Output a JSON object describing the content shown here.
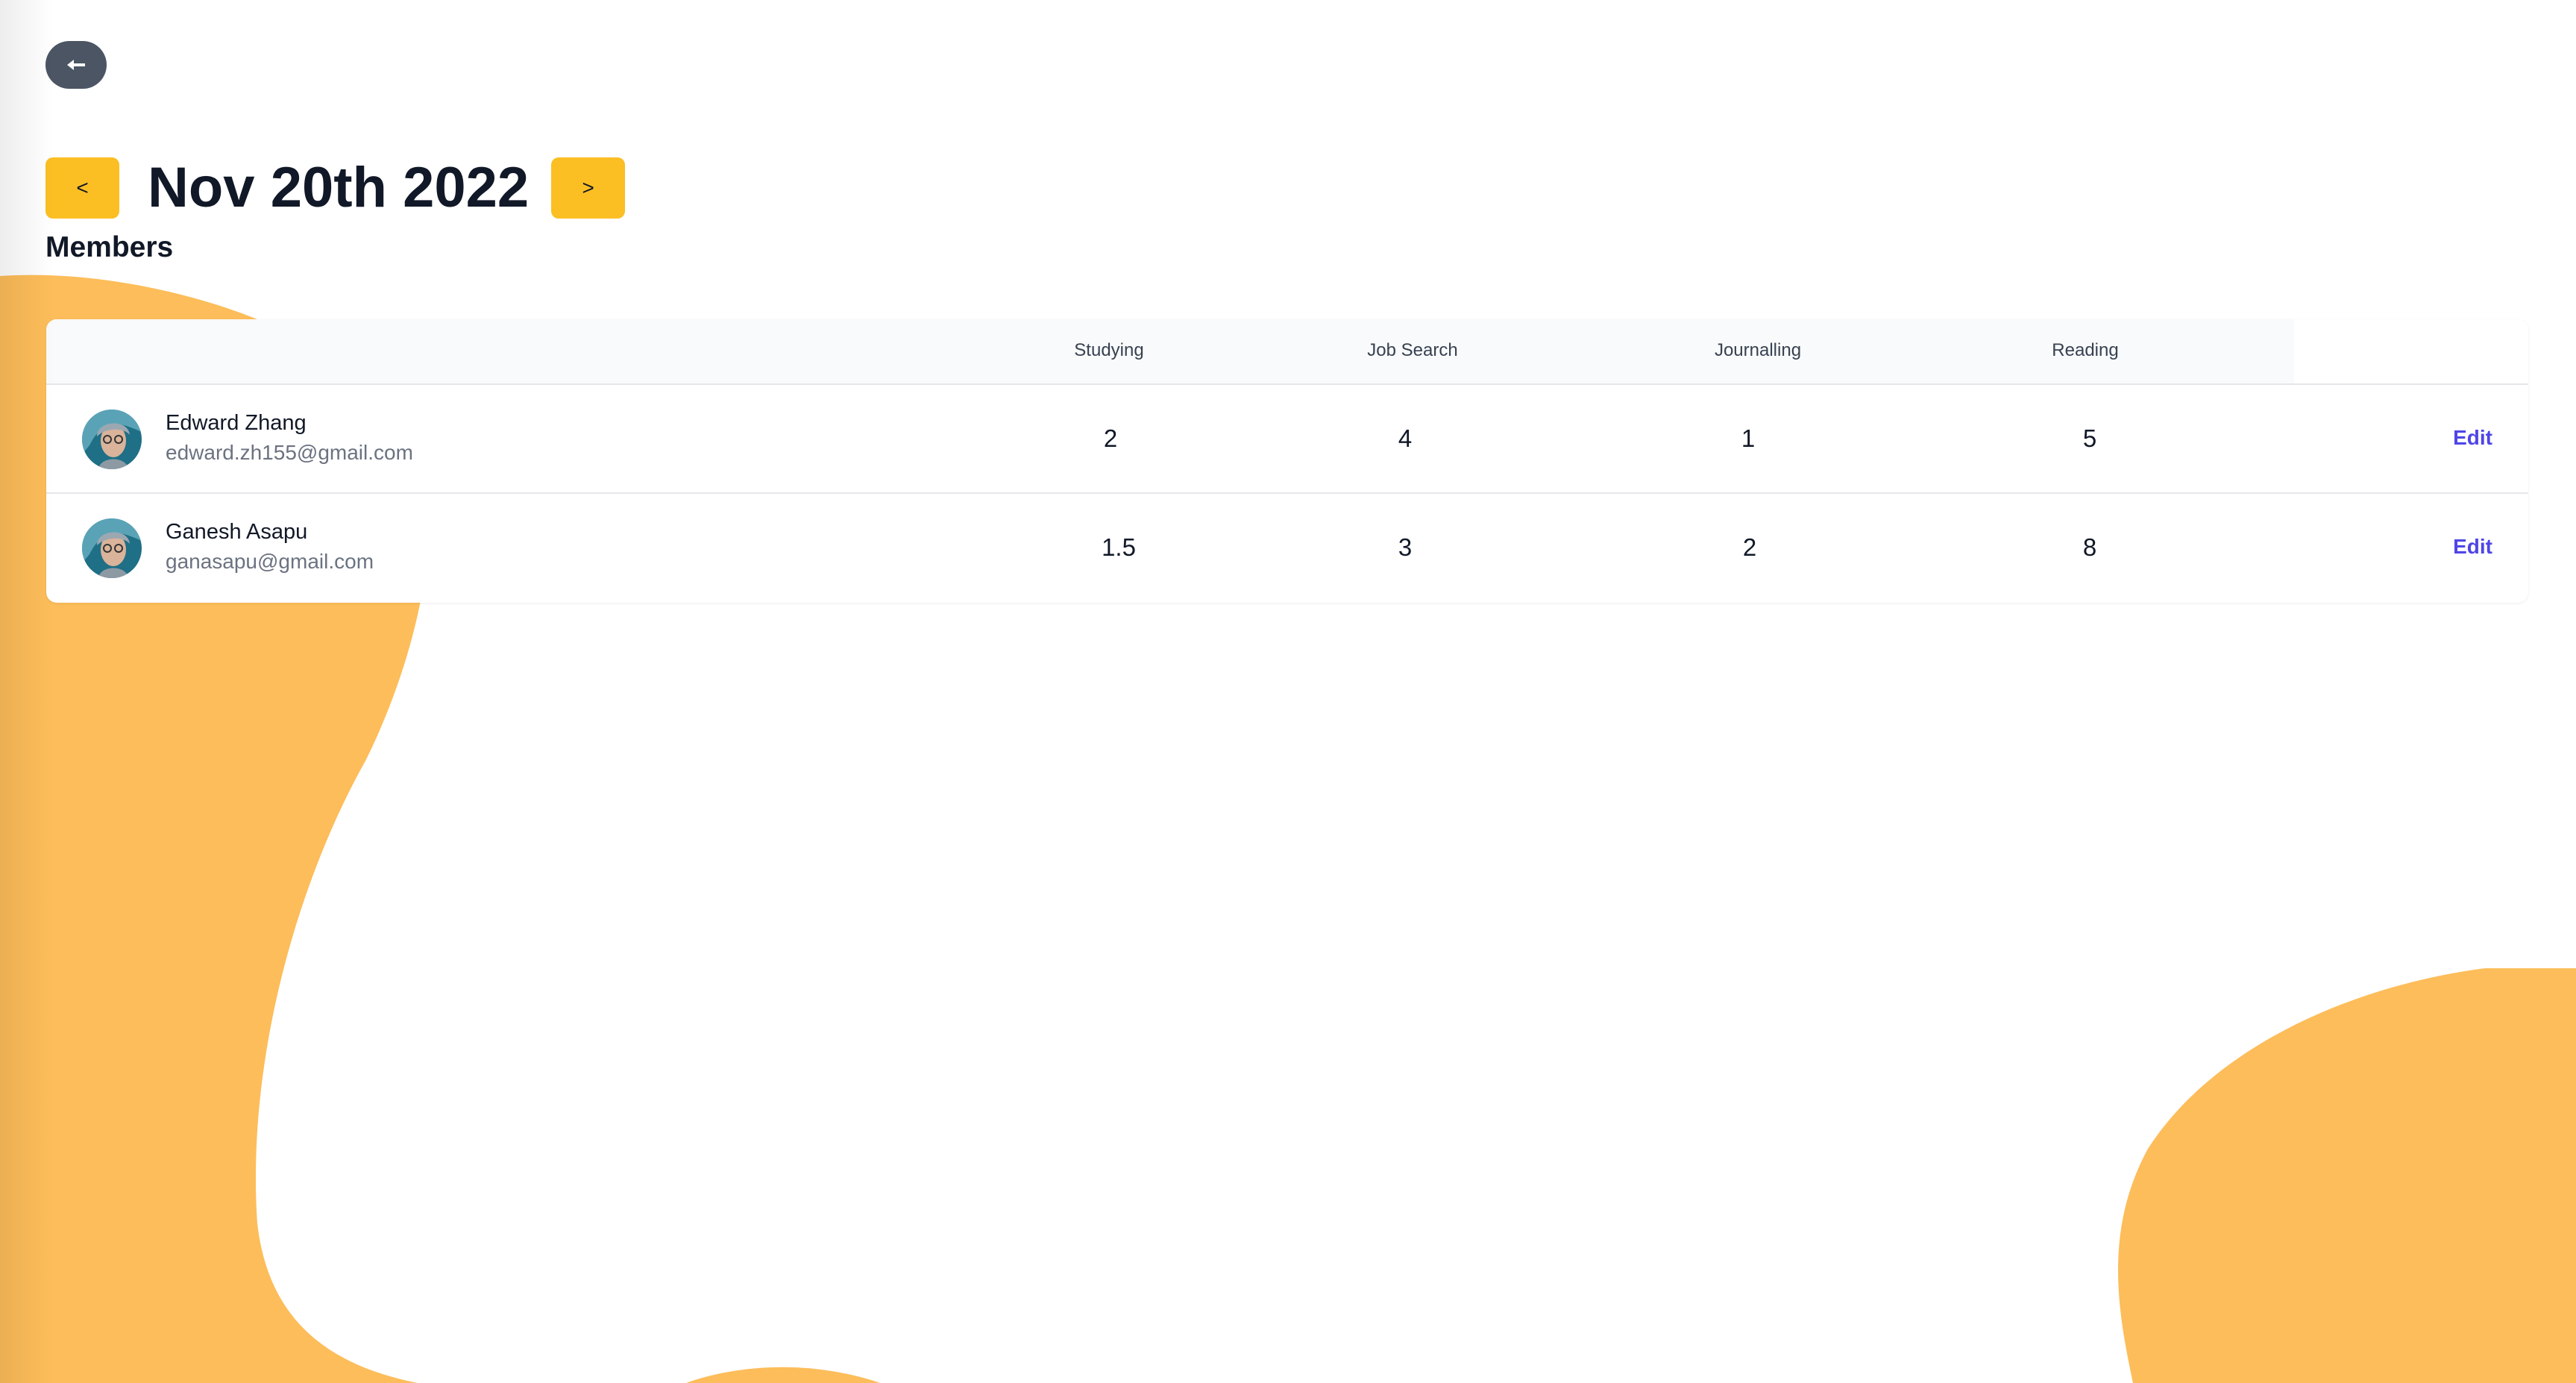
{
  "navigation": {
    "back_icon": "arrow-left-icon",
    "prev_label": "<",
    "next_label": ">",
    "current_date": "Nov 20th 2022"
  },
  "section": {
    "title": "Members"
  },
  "table": {
    "columns": [
      "Studying",
      "Job Search",
      "Journalling",
      "Reading"
    ],
    "rows": [
      {
        "name": "Edward Zhang",
        "email": "edward.zh155@gmail.com",
        "values": [
          "2",
          "4",
          "1",
          "5"
        ],
        "action": "Edit"
      },
      {
        "name": "Ganesh Asapu",
        "email": "ganasapu@gmail.com",
        "values": [
          "1.5",
          "3",
          "2",
          "8"
        ],
        "action": "Edit"
      }
    ]
  },
  "colors": {
    "accent_yellow": "#fbbf24",
    "blob_orange": "#fdbd5a",
    "back_button": "#4b5563",
    "link": "#4f46e5"
  }
}
